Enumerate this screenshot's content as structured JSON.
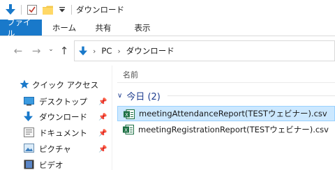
{
  "window": {
    "title": "ダウンロード"
  },
  "ribbon": {
    "tabs": [
      {
        "label": "ファイル"
      },
      {
        "label": "ホーム"
      },
      {
        "label": "共有"
      },
      {
        "label": "表示"
      }
    ]
  },
  "address": {
    "crumbs": [
      "PC",
      "ダウンロード"
    ]
  },
  "sidebar": {
    "quick_access": "クイック アクセス",
    "items": [
      {
        "label": "デスクトップ",
        "icon": "desktop-icon",
        "pinned": true
      },
      {
        "label": "ダウンロード",
        "icon": "download-icon",
        "pinned": true
      },
      {
        "label": "ドキュメント",
        "icon": "document-icon",
        "pinned": true
      },
      {
        "label": "ピクチャ",
        "icon": "picture-icon",
        "pinned": true
      },
      {
        "label": "ビデオ",
        "icon": "video-icon",
        "pinned": false
      }
    ]
  },
  "content": {
    "column_name": "名前",
    "group_label": "今日 (2)",
    "files": [
      {
        "name": "meetingAttendanceReport(TESTウェビナー).csv",
        "selected": true,
        "icon": "excel-csv-icon"
      },
      {
        "name": "meetingRegistrationReport(TESTウェビナー).csv",
        "selected": false,
        "icon": "excel-csv-icon"
      }
    ]
  },
  "colors": {
    "accent": "#1979ca",
    "selection_bg": "#cce8ff",
    "selection_border": "#99d1ff",
    "group_text": "#1e3d8f",
    "excel_green": "#1d7044"
  }
}
